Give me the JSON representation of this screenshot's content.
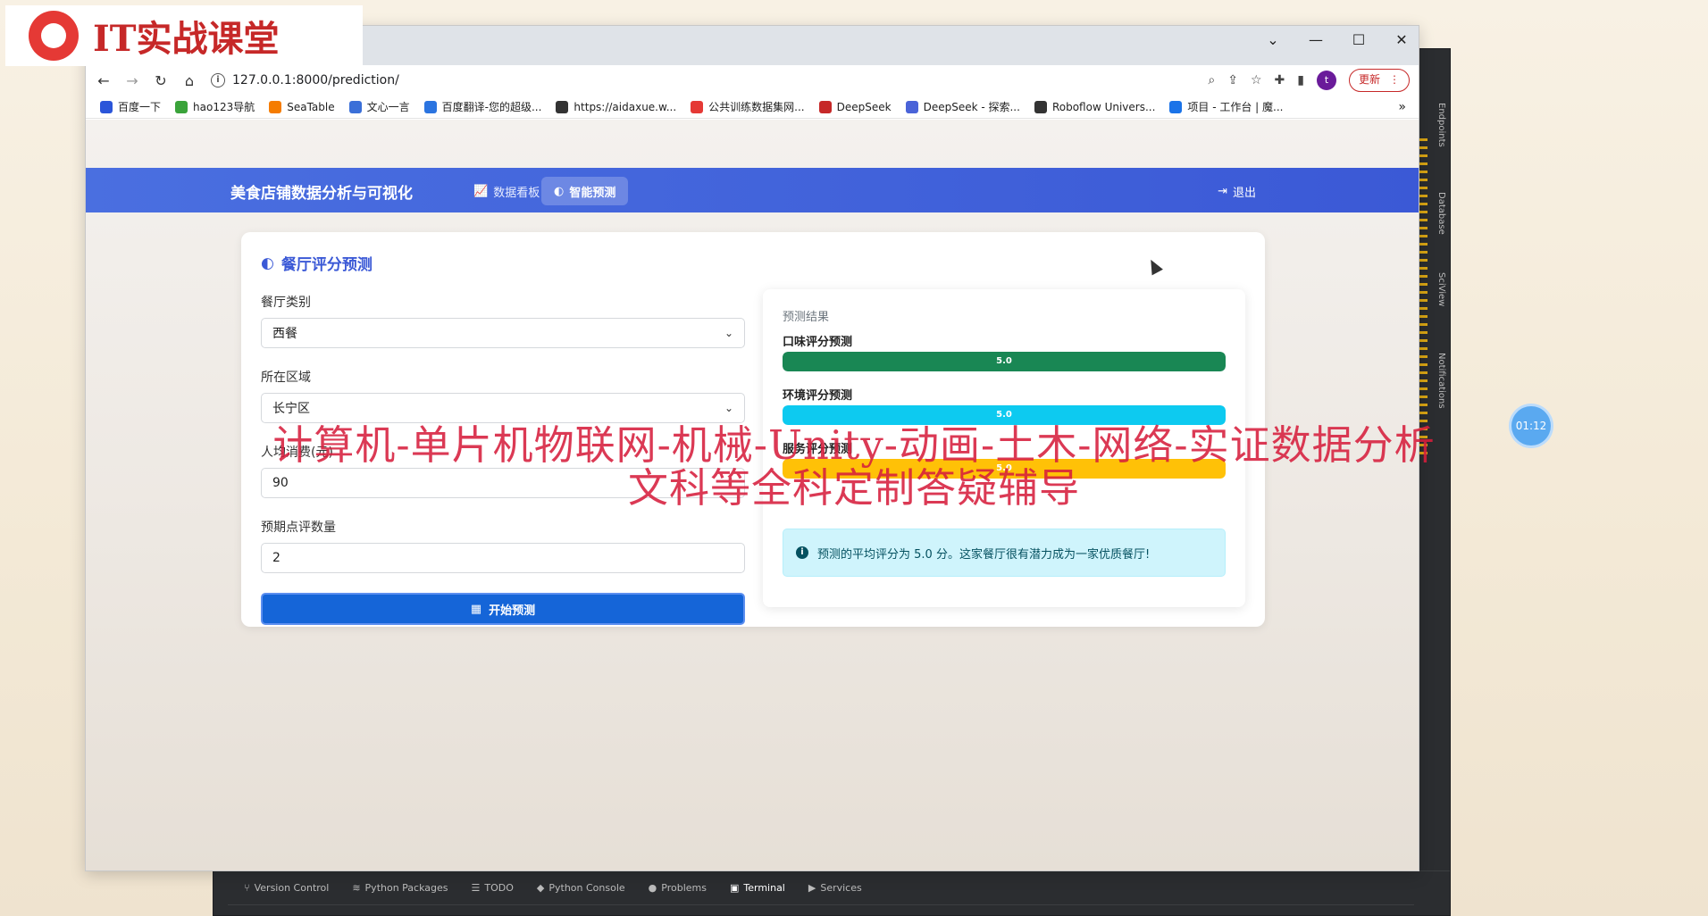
{
  "browser": {
    "url": "127.0.0.1:8000/prediction/",
    "update_label": "更新",
    "avatar_letter": "t",
    "bookmarks": [
      {
        "label": "百度一下",
        "color": "#2b55d9"
      },
      {
        "label": "hao123导航",
        "color": "#3aa33a"
      },
      {
        "label": "SeaTable",
        "color": "#f57c00"
      },
      {
        "label": "文心一言",
        "color": "#3a6fd8"
      },
      {
        "label": "百度翻译-您的超级...",
        "color": "#2b74e0"
      },
      {
        "label": "https://aidaxue.w...",
        "color": "#333333"
      },
      {
        "label": "公共训练数据集网...",
        "color": "#e53935"
      },
      {
        "label": "DeepSeek",
        "color": "#c62828"
      },
      {
        "label": "DeepSeek - 探索...",
        "color": "#4a63d8"
      },
      {
        "label": "Roboflow Univers...",
        "color": "#333333"
      },
      {
        "label": "项目 - 工作台 | 魔...",
        "color": "#1a73e8"
      }
    ]
  },
  "navbar": {
    "brand": "美食店铺数据分析与可视化",
    "links": [
      {
        "label": "数据看板",
        "icon": "chart-line-icon"
      },
      {
        "label": "智能预测",
        "icon": "brain-icon",
        "active": true
      }
    ],
    "logout": "退出"
  },
  "card": {
    "title": "餐厅评分预测",
    "form": {
      "category_label": "餐厅类别",
      "category_value": "西餐",
      "district_label": "所在区域",
      "district_value": "长宁区",
      "price_label": "人均消费(元)",
      "price_value": "90",
      "reviews_label": "预期点评数量",
      "reviews_value": "2",
      "submit_label": "开始预测"
    },
    "result": {
      "title": "预测结果",
      "taste_label": "口味评分预测",
      "taste_value": "5.0",
      "env_label": "环境评分预测",
      "env_value": "5.0",
      "service_label": "服务评分预测",
      "service_value": "5.0",
      "bar_fill_percent": 100,
      "alert": "预测的平均评分为 5.0 分。这家餐厅很有潜力成为一家优质餐厅!"
    },
    "colors": {
      "taste": "#198754",
      "env": "#0dcaf0",
      "service": "#ffc107"
    }
  },
  "ide": {
    "right_tabs": [
      "Endpoints",
      "Database",
      "SciView",
      "Notifications"
    ],
    "bottom_tabs": [
      "Version Control",
      "Python Packages",
      "TODO",
      "Python Console",
      "Problems",
      "Terminal",
      "Services"
    ],
    "active_tab": "Terminal"
  },
  "overlay": {
    "logo_text": "IT实战课堂",
    "watermark_line1": "计算机-单片机物联网-机械-Unity-动画-土木-网络-实证数据分析",
    "watermark_line2": "文科等全科定制答疑辅导",
    "timer": "01:12"
  }
}
